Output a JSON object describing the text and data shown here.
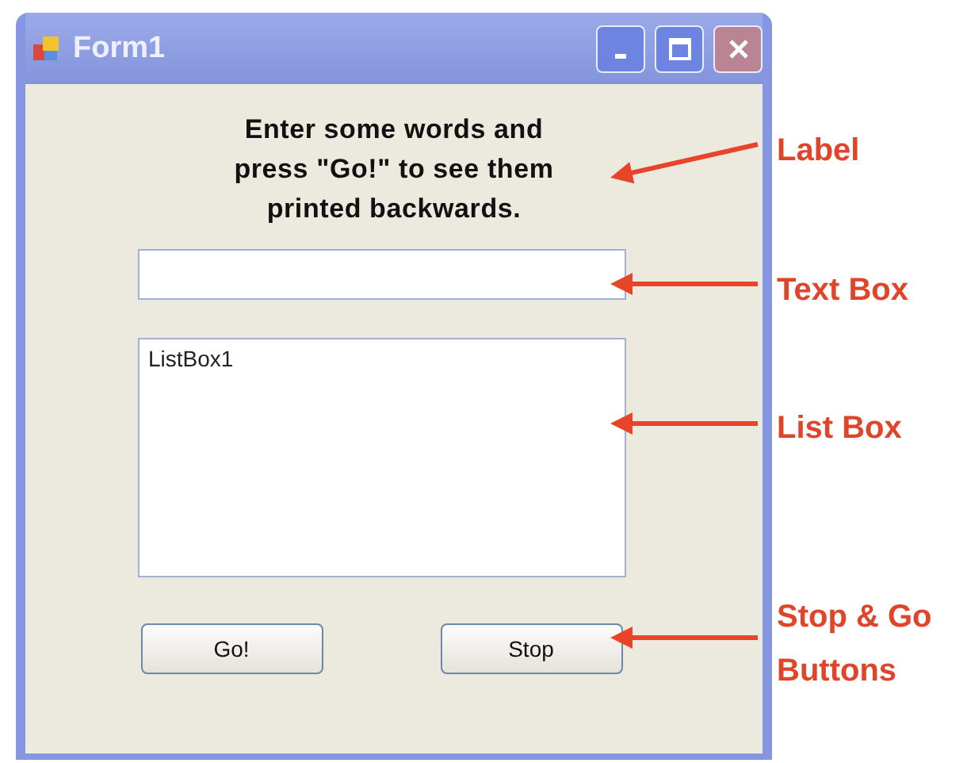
{
  "window": {
    "title": "Form1"
  },
  "label": {
    "lines": [
      "Enter some words and",
      "press \"Go!\" to see them",
      "printed backwards."
    ]
  },
  "list_box": {
    "items": [
      "ListBox1"
    ]
  },
  "buttons": [
    "Go!",
    "Stop"
  ],
  "annotations": [
    {
      "text": "Label"
    },
    {
      "text": "Text Box"
    },
    {
      "text": "List Box"
    },
    {
      "text": "Stop & Go\nButtons"
    }
  ]
}
